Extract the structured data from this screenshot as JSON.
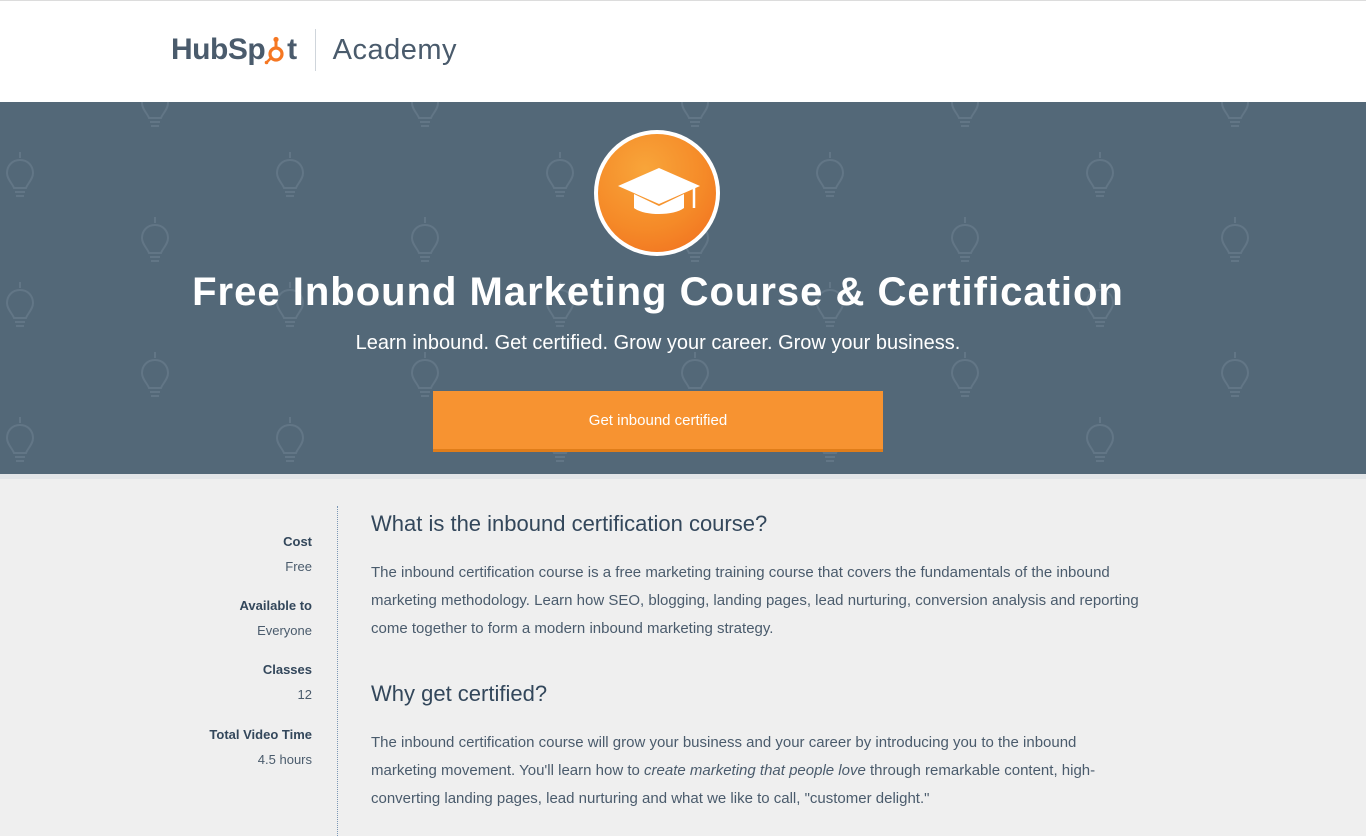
{
  "header": {
    "logo_text_left": "HubSp",
    "logo_text_right": "t",
    "academy_label": "Academy"
  },
  "hero": {
    "icon": "graduation-cap-icon",
    "title": "Free Inbound Marketing Course & Certification",
    "subtitle": "Learn inbound. Get certified. Grow your career. Grow your business.",
    "cta_label": "Get inbound certified",
    "colors": {
      "background": "#536878",
      "cta": "#f79331",
      "badge": "#f58a28"
    }
  },
  "course_meta": [
    {
      "label": "Cost",
      "value": "Free"
    },
    {
      "label": "Available to",
      "value": "Everyone"
    },
    {
      "label": "Classes",
      "value": "12"
    },
    {
      "label": "Total Video Time",
      "value": "4.5 hours"
    }
  ],
  "content": {
    "section1_heading": "What is the inbound certification course?",
    "section1_body": "The inbound certification course is a free marketing training course that covers the fundamentals of the inbound marketing methodology. Learn how SEO, blogging, landing pages, lead nurturing, conversion analysis and reporting come together to form a modern inbound marketing strategy.",
    "section2_heading": "Why get certified?",
    "section2_body_before": "The inbound certification course will grow your business and your career by introducing you to the inbound marketing movement. You'll learn how to ",
    "section2_body_emphasis": "create marketing that people love",
    "section2_body_after": " through remarkable content, high-converting landing pages, lead nurturing and what we like to call, \"customer delight.\""
  }
}
